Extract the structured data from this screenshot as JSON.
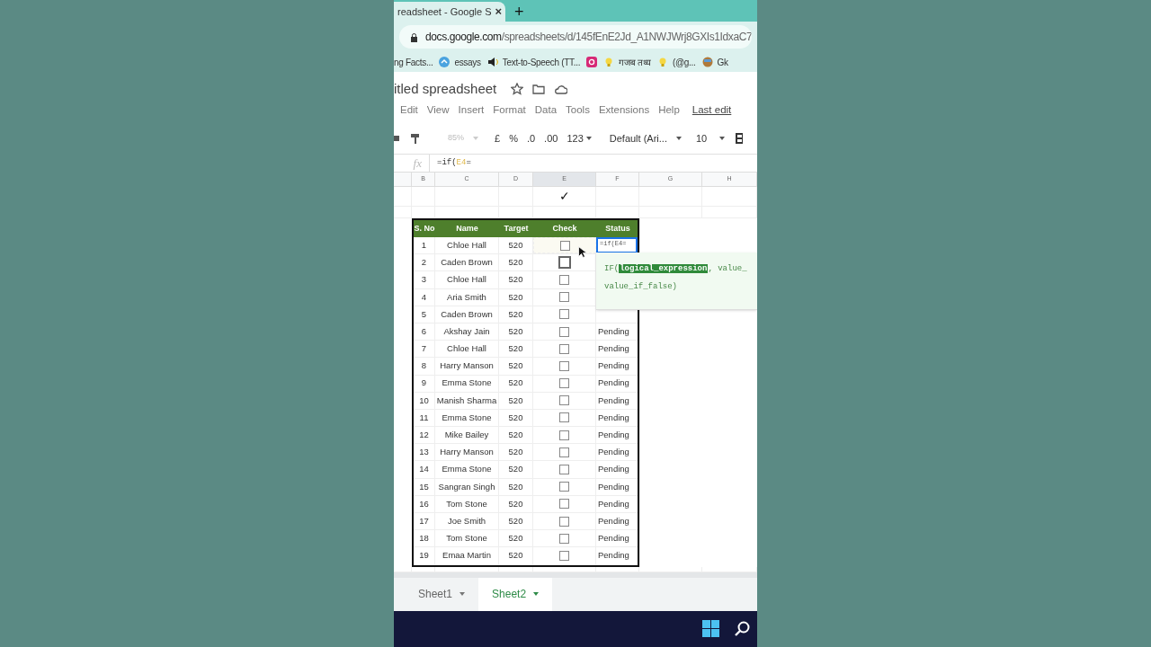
{
  "browser": {
    "tab_title": "readsheet - Google S",
    "tab_close": "×",
    "new_tab": "+",
    "url_domain": "docs.google.com",
    "url_path": "/spreadsheets/d/145fEnE2Jd_A1NWJWrj8GXIs1IdxaC7",
    "bookmarks": [
      {
        "kind": "none",
        "label": "ng Facts..."
      },
      {
        "kind": "circle",
        "label": "essays"
      },
      {
        "kind": "speaker",
        "label": "Text-to-Speech (TT..."
      },
      {
        "kind": "camera"
      },
      {
        "kind": "bulb",
        "label": "गजब तथ्य"
      },
      {
        "kind": "bulb",
        "label": "(@g..."
      },
      {
        "kind": "face",
        "label": "Gk"
      }
    ]
  },
  "doc": {
    "title": "itled spreadsheet",
    "menu": [
      "Edit",
      "View",
      "Insert",
      "Format",
      "Data",
      "Tools",
      "Extensions",
      "Help"
    ],
    "last_edit": "Last edit"
  },
  "toolbar": {
    "zoom": "85%",
    "currency": "£",
    "percent": "%",
    "dec_less": ".0",
    "dec_more": ".00",
    "number_format": "123",
    "font": "Default (Ari...",
    "font_size": "10"
  },
  "formula_bar": {
    "fx": "fx",
    "prefix": "=if(",
    "ref": "E4",
    "suffix": "="
  },
  "columns": [
    "B",
    "C",
    "D",
    "E",
    "F",
    "G",
    "H"
  ],
  "check_mark": "✓",
  "table": {
    "headers": [
      "S. No",
      "Name",
      "Target",
      "Check",
      "Status"
    ],
    "rows": [
      {
        "no": "1",
        "name": "Chloe Hall",
        "target": "520",
        "checked": false,
        "status": "=if(E4=",
        "editing": true
      },
      {
        "no": "2",
        "name": "Caden Brown",
        "target": "520",
        "checked": false,
        "hover": true
      },
      {
        "no": "3",
        "name": "Chloe Hall",
        "target": "520",
        "checked": false
      },
      {
        "no": "4",
        "name": "Aria Smith",
        "target": "520",
        "checked": false
      },
      {
        "no": "5",
        "name": "Caden Brown",
        "target": "520",
        "checked": false
      },
      {
        "no": "6",
        "name": "Akshay Jain",
        "target": "520",
        "checked": false,
        "status": "Pending"
      },
      {
        "no": "7",
        "name": "Chloe Hall",
        "target": "520",
        "checked": false,
        "status": "Pending"
      },
      {
        "no": "8",
        "name": "Harry Manson",
        "target": "520",
        "checked": false,
        "status": "Pending"
      },
      {
        "no": "9",
        "name": "Emma Stone",
        "target": "520",
        "checked": false,
        "status": "Pending"
      },
      {
        "no": "10",
        "name": "Manish Sharma",
        "target": "520",
        "checked": false,
        "status": "Pending"
      },
      {
        "no": "11",
        "name": "Emma Stone",
        "target": "520",
        "checked": false,
        "status": "Pending"
      },
      {
        "no": "12",
        "name": "Mike Bailey",
        "target": "520",
        "checked": false,
        "status": "Pending"
      },
      {
        "no": "13",
        "name": "Harry Manson",
        "target": "520",
        "checked": false,
        "status": "Pending"
      },
      {
        "no": "14",
        "name": "Emma Stone",
        "target": "520",
        "checked": false,
        "status": "Pending"
      },
      {
        "no": "15",
        "name": "Sangran Singh",
        "target": "520",
        "checked": false,
        "status": "Pending"
      },
      {
        "no": "16",
        "name": "Tom Stone",
        "target": "520",
        "checked": false,
        "status": "Pending"
      },
      {
        "no": "17",
        "name": "Joe Smith",
        "target": "520",
        "checked": false,
        "status": "Pending"
      },
      {
        "no": "18",
        "name": "Tom Stone",
        "target": "520",
        "checked": false,
        "status": "Pending"
      },
      {
        "no": "19",
        "name": "Emaa Martin",
        "target": "520",
        "checked": false,
        "status": "Pending"
      }
    ]
  },
  "tooltip": {
    "function": "IF(",
    "argument": "logical_expression",
    "rest": ", value_",
    "line2": "value_if_false)"
  },
  "sheets": [
    {
      "label": "Sheet1",
      "selected": false
    },
    {
      "label": "Sheet2",
      "selected": true
    }
  ]
}
